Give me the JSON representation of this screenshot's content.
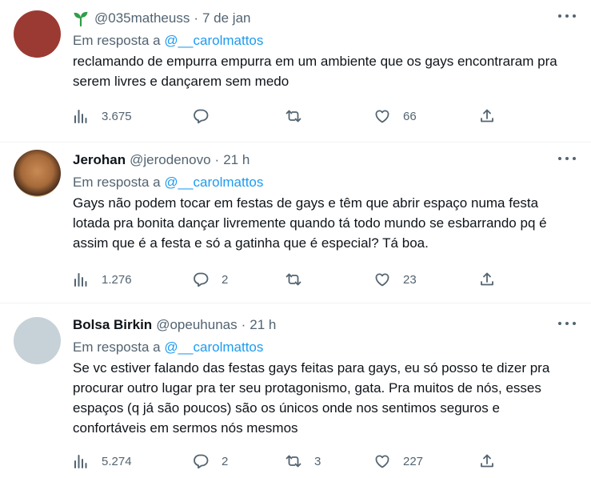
{
  "tweets": [
    {
      "name": "",
      "handle": "@035matheuss",
      "sep": "·",
      "time": "7 de jan",
      "avatar_color": "#9b3a32",
      "has_sprout": true,
      "reply_prefix": "Em resposta a",
      "reply_to": "@__carolmattos",
      "text": "reclamando de empurra empurra em um ambiente que os gays encontraram pra serem livres e dançarem sem medo",
      "views": "3.675",
      "replies": "",
      "retweets": "",
      "likes": "66"
    },
    {
      "name": "Jerohan",
      "handle": "@jerodenovo",
      "sep": "·",
      "time": "21 h",
      "avatar_color": "#c98b55",
      "has_sprout": false,
      "reply_prefix": "Em resposta a",
      "reply_to": "@__carolmattos",
      "text": "Gays não podem tocar em festas de gays e têm que abrir espaço numa festa lotada pra bonita dançar livremente quando tá todo mundo se esbarrando pq é assim que é a festa e só a gatinha que é especial? Tá boa.",
      "views": "1.276",
      "replies": "2",
      "retweets": "",
      "likes": "23"
    },
    {
      "name": "Bolsa Birkin",
      "handle": "@opeuhunas",
      "sep": "·",
      "time": "21 h",
      "avatar_color": "#c7d1d8",
      "has_sprout": false,
      "reply_prefix": "Em resposta a",
      "reply_to": "@__carolmattos",
      "text": "Se vc estiver falando das festas gays feitas para gays, eu só posso te dizer pra procurar outro lugar pra ter seu protagonismo, gata. Pra muitos de nós, esses espaços (q já são poucos) são os únicos onde nos sentimos seguros e confortáveis em sermos nós mesmos",
      "views": "5.274",
      "replies": "2",
      "retweets": "3",
      "likes": "227"
    }
  ],
  "icons": {
    "views": "bar-chart-icon",
    "reply": "speech-bubble-icon",
    "retweet": "retweet-icon",
    "like": "heart-icon",
    "share": "share-upload-icon",
    "more": "more-dots-icon",
    "sprout": "sprout-icon"
  },
  "colors": {
    "link": "#1d9bf0",
    "secondary_text": "#536471",
    "primary_text": "#0f1419",
    "divider": "#eff3f4",
    "sprout": "#2e9e47"
  }
}
